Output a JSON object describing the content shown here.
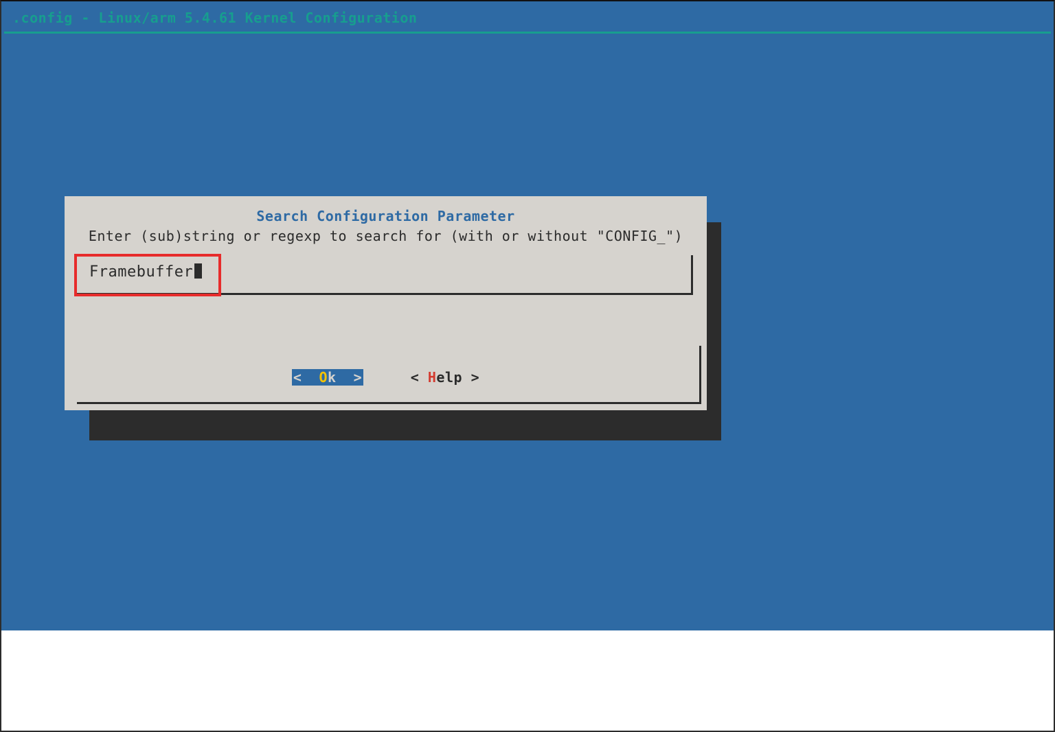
{
  "window": {
    "title": ".config - Linux/arm 5.4.61 Kernel Configuration"
  },
  "dialog": {
    "title": "Search Configuration Parameter",
    "prompt": "Enter (sub)string or regexp to search for (with or without \"CONFIG_\")",
    "input_value": "Framebuffer",
    "buttons": {
      "ok": {
        "open": "<  ",
        "hot": "O",
        "rest": "k  >"
      },
      "help": {
        "open": "< ",
        "hot": "H",
        "rest": "elp >"
      }
    }
  },
  "annotation": {
    "highlight": "search-input"
  }
}
